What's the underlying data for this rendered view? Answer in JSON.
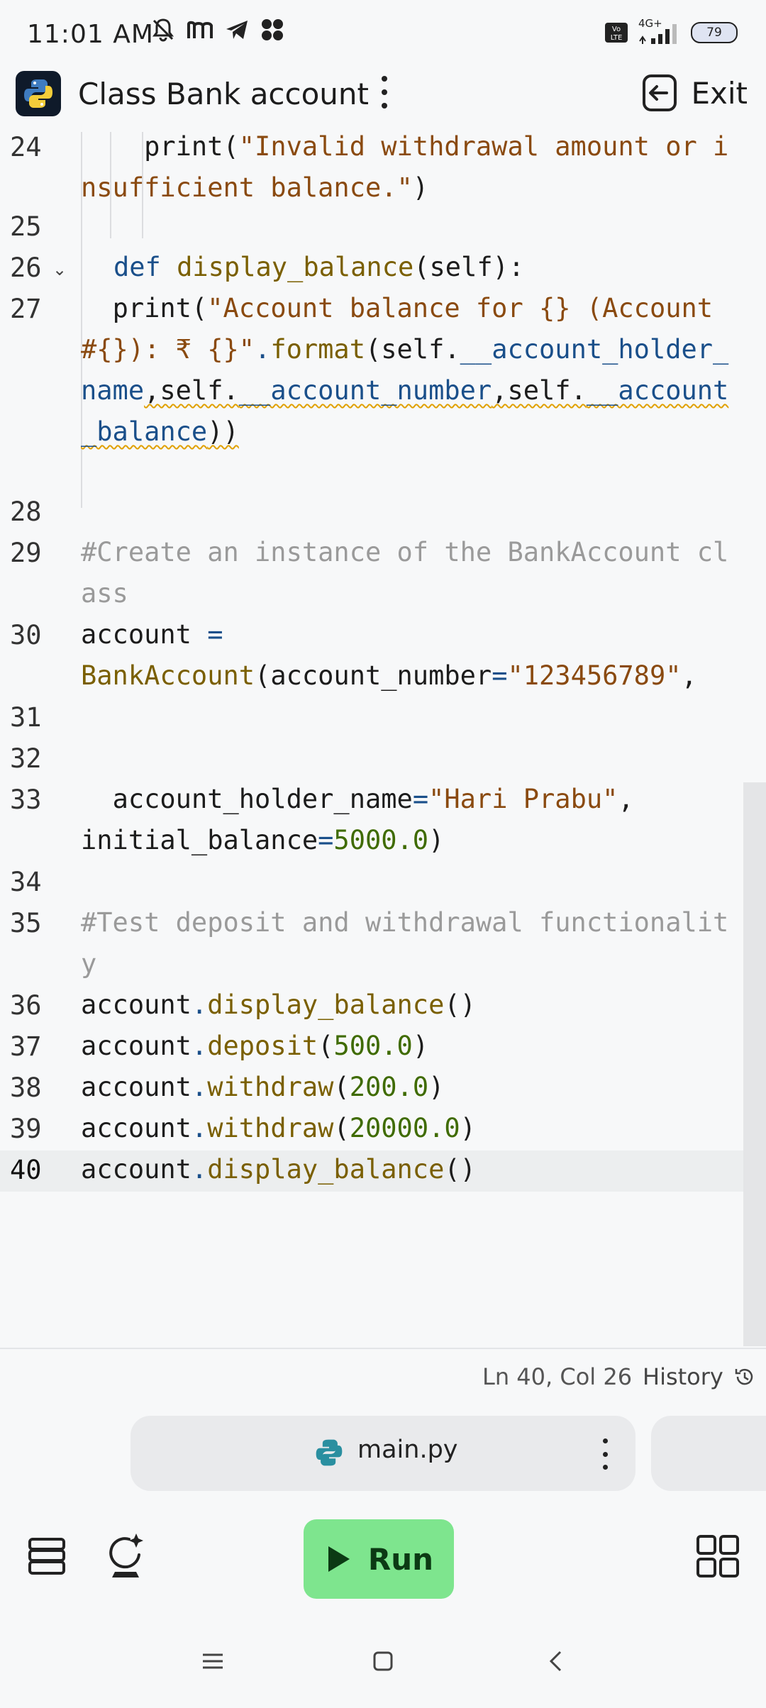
{
  "status_bar": {
    "time": "11:01 AM",
    "network": "4G+",
    "battery": "79"
  },
  "header": {
    "title": "Class Bank account",
    "exit_label": "Exit"
  },
  "editor": {
    "lines": [
      {
        "n": "24"
      },
      {
        "n": "25"
      },
      {
        "n": "26"
      },
      {
        "n": "27"
      },
      {
        "n": "28"
      },
      {
        "n": "29"
      },
      {
        "n": "30"
      },
      {
        "n": "31"
      },
      {
        "n": "32"
      },
      {
        "n": "33"
      },
      {
        "n": "34"
      },
      {
        "n": "35"
      },
      {
        "n": "36"
      },
      {
        "n": "37"
      },
      {
        "n": "38"
      },
      {
        "n": "39"
      },
      {
        "n": "40"
      }
    ],
    "code": {
      "l24_a": "    print(",
      "l24_b": "\"Invalid withdrawal amount or insufficient balance.\"",
      "l24_c": ")",
      "l26_a": "def ",
      "l26_b": "display_balance",
      "l26_c": "(self):",
      "l27_a": "print(",
      "l27_b": "\"Account balance for {} (Account #{}): ₹ {}\"",
      "l27_c": ".",
      "l27_d": "format",
      "l27_e": "(self.",
      "l27_f": "__account_holder_name",
      "l27_g": ",self.",
      "l27_h": "__account_number",
      "l27_i": ",self.",
      "l27_j": "__account_balance",
      "l27_k": "))",
      "l29": "#Create an instance of the BankAccount class",
      "l30_a": "account ",
      "l30_b": "=",
      "l30_c": "BankAccount",
      "l30_d": "(account_number",
      "l30_e": "=",
      "l30_f": "\"123456789\"",
      "l30_g": ",",
      "l33_a": "  account_holder_name",
      "l33_b": "=",
      "l33_c": "\"Hari Prabu\"",
      "l33_d": ",",
      "l33_e": "initial_balance",
      "l33_f": "=",
      "l33_g": "5000.0",
      "l33_h": ")",
      "l35": "#Test deposit and withdrawal functionality",
      "l36_a": "account",
      "l36_b": ".",
      "l36_c": "display_balance",
      "l36_d": "()",
      "l37_a": "account",
      "l37_b": ".",
      "l37_c": "deposit",
      "l37_d": "(",
      "l37_e": "500.0",
      "l37_f": ")",
      "l38_a": "account",
      "l38_b": ".",
      "l38_c": "withdraw",
      "l38_d": "(",
      "l38_e": "200.0",
      "l38_f": ")",
      "l39_a": "account",
      "l39_b": ".",
      "l39_c": "withdraw",
      "l39_d": "(",
      "l39_e": "20000.0",
      "l39_f": ")",
      "l40_a": "account",
      "l40_b": ".",
      "l40_c": "display_balance",
      "l40_d": "()"
    }
  },
  "statusline": {
    "cursor": "Ln 40, Col 26",
    "history_label": "History"
  },
  "files": {
    "active_tab": "main.py"
  },
  "toolbar": {
    "run_label": "Run"
  },
  "colors": {
    "run_green": "#7ee58e",
    "keyword_blue": "#1a4f8a",
    "string_brown": "#8a4a10",
    "number_green": "#3f6b00",
    "comment_gray": "#9a9a9a"
  }
}
